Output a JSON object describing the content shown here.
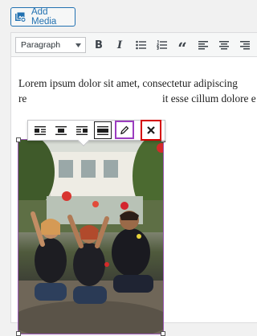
{
  "media": {
    "add_media_label": "Add Media"
  },
  "toolbar": {
    "format_select_value": "Paragraph",
    "buttons": [
      "bold-button",
      "italic-button",
      "bulleted-list-button",
      "numbered-list-button",
      "blockquote-button",
      "align-left-button",
      "align-center-button",
      "align-right-button"
    ],
    "bold_glyph": "B",
    "italic_glyph": "I",
    "quote_glyph": "“"
  },
  "content": {
    "line1": "Lorem ipsum dolor sit amet, consectetur adipiscing",
    "line2_start": "re",
    "line2_end": "it esse cillum dolore e"
  },
  "image_toolbar": {
    "buttons": [
      "align-left-icon",
      "align-center-icon",
      "align-right-icon",
      "align-none-icon",
      "pencil-icon",
      "close-icon"
    ],
    "active": "align-none-icon",
    "highlight_colors": {
      "edit": "#9b3dbf",
      "remove": "#d40000"
    }
  },
  "colors": {
    "accent": "#2271b1",
    "selection": "#9b59b6"
  },
  "image": {
    "description_icon": "photo-of-group-sitting-outdoors"
  }
}
